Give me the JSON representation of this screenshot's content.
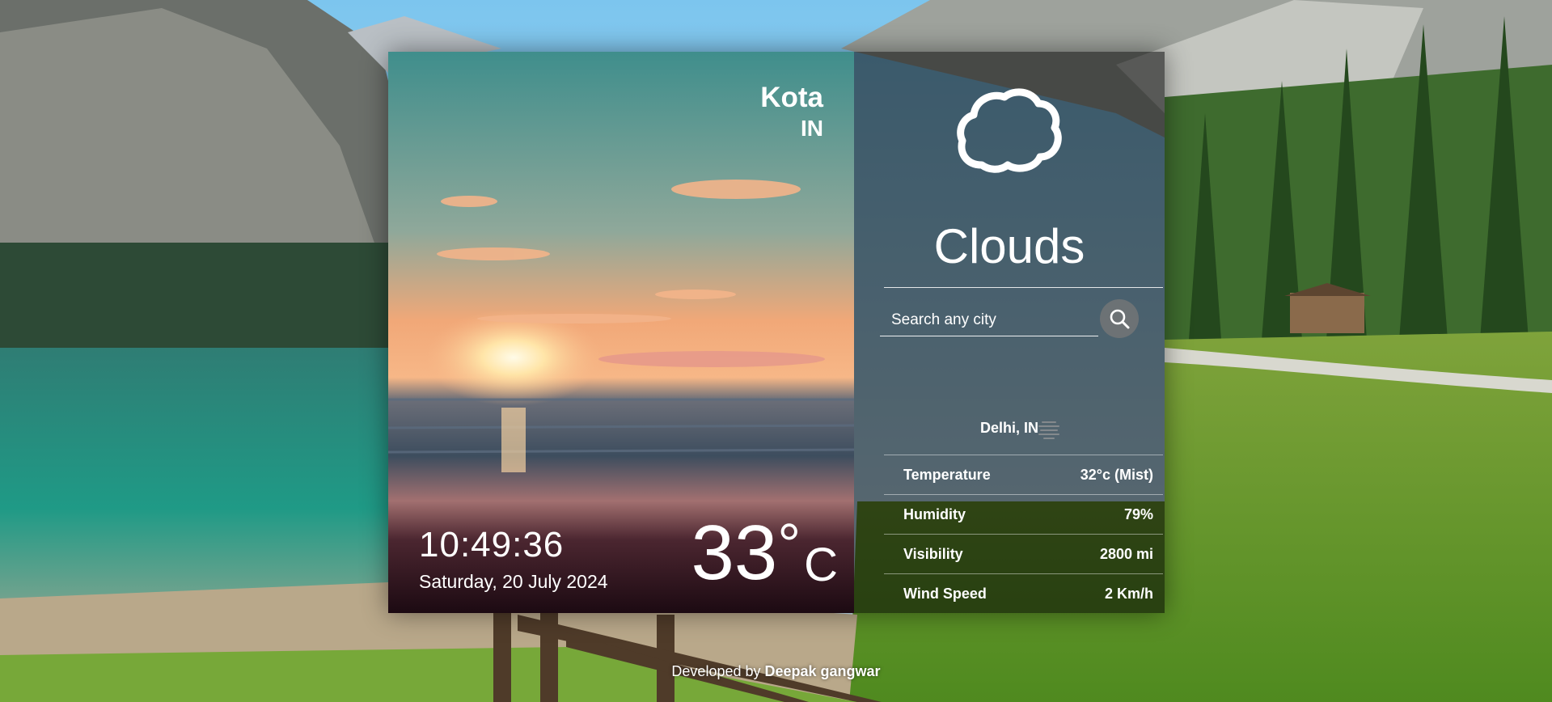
{
  "location": {
    "city": "Kota",
    "country": "IN"
  },
  "clock": {
    "time": "10:49:36",
    "date": "Saturday, 20 July 2024"
  },
  "current_temp": {
    "value": "33",
    "degree_symbol": "°",
    "unit": "C"
  },
  "weather": {
    "condition": "Clouds",
    "icon": "cloud-icon"
  },
  "search": {
    "placeholder": "Search any city",
    "button_icon": "search-icon"
  },
  "search_result": {
    "city": "Delhi, IN",
    "icon": "mist-icon",
    "details": [
      {
        "label": "Temperature",
        "value": "32°c (Mist)"
      },
      {
        "label": "Humidity",
        "value": "79%"
      },
      {
        "label": "Visibility",
        "value": "2800 mi"
      },
      {
        "label": "Wind Speed",
        "value": "2 Km/h"
      }
    ]
  },
  "footer": {
    "prefix": "Developed by ",
    "author": "Deepak gangwar"
  },
  "colors": {
    "panel_overlay": "#000000",
    "text": "#ffffff",
    "search_button": "#787878"
  }
}
